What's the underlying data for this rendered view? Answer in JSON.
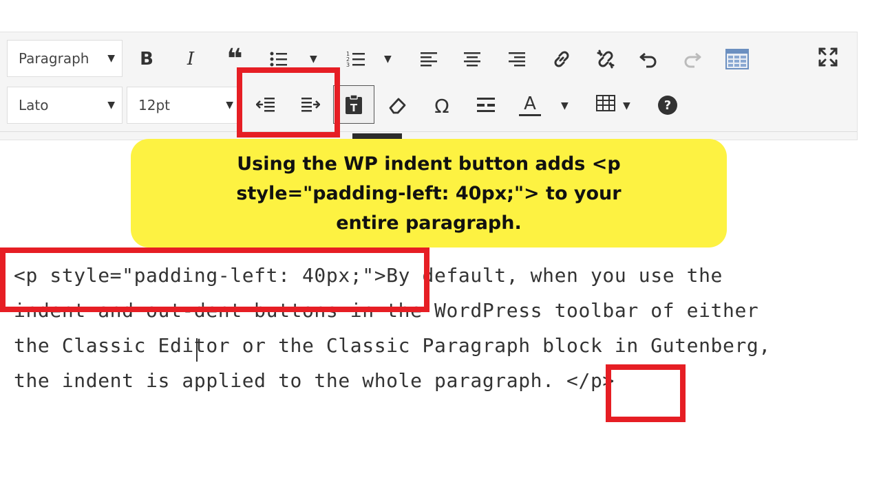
{
  "toolbar": {
    "format_select": "Paragraph",
    "font_family_select": "Lato",
    "font_size_select": "12pt",
    "icons_row1": [
      "bold-icon",
      "italic-icon",
      "blockquote-icon",
      "bulleted-list-icon",
      "numbered-list-icon",
      "align-left-icon",
      "align-center-icon",
      "align-right-icon",
      "insert-link-icon",
      "remove-link-icon",
      "undo-icon",
      "redo-icon",
      "toolbar-toggle-icon",
      "fullscreen-icon"
    ],
    "icons_row2": [
      "outdent-icon",
      "indent-icon",
      "paste-as-text-icon",
      "clear-formatting-icon",
      "special-character-icon",
      "horizontal-line-icon",
      "text-color-icon",
      "table-icon",
      "help-icon"
    ],
    "bold_label": "B",
    "italic_label": "I",
    "quote_label": "❝",
    "special_char_label": "Ω",
    "text_color_label": "A",
    "help_label": "?"
  },
  "callout": {
    "text": "Using the WP indent button adds <p style=\"padding-left: 40px;\"> to your entire paragraph."
  },
  "editor": {
    "line1_tag": "<p style=\"padding-left: 40px;\">",
    "line1_text": "By default, when you use the",
    "line2": "indent and out-dent buttons in the WordPress toolbar of either",
    "line3": "the Classic Editor or the Classic Paragraph block in Gutenberg,",
    "line4_text": "the indent is applied to the whole paragraph. ",
    "line4_tag": "</p>"
  },
  "colors": {
    "highlight_border": "#e61e24",
    "callout_background": "#fdf242",
    "toolbar_background": "#f5f5f5"
  }
}
